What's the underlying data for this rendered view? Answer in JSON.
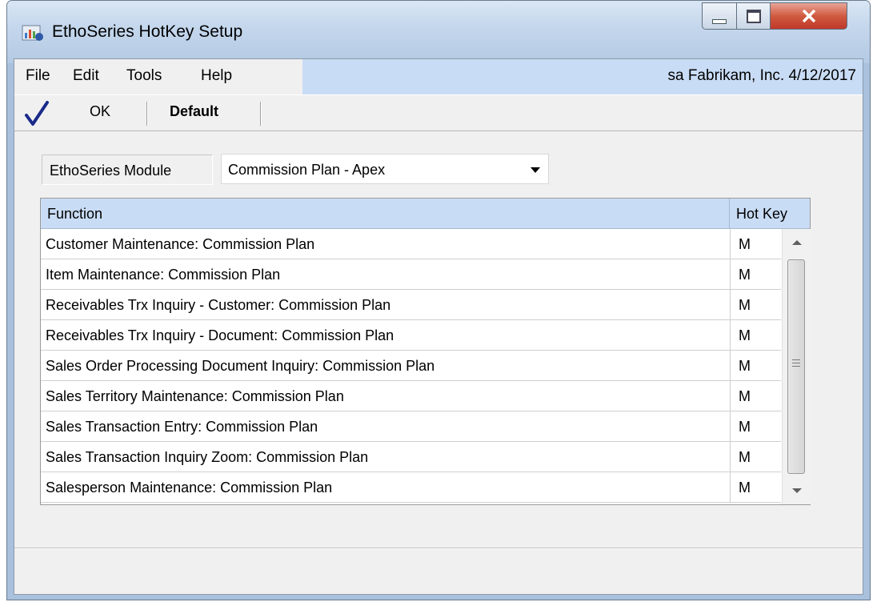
{
  "window": {
    "title": "EthoSeries HotKey Setup"
  },
  "menu": {
    "file": "File",
    "edit": "Edit",
    "tools": "Tools",
    "help": "Help",
    "info": "sa  Fabrikam, Inc.  4/12/2017"
  },
  "toolbar": {
    "ok_label": "OK",
    "default_label": "Default"
  },
  "module": {
    "label": "EthoSeries Module",
    "value": "Commission Plan - Apex"
  },
  "grid": {
    "columns": {
      "function": "Function",
      "hotkey": "Hot Key"
    },
    "rows": [
      {
        "function": "Customer Maintenance: Commission Plan",
        "hotkey": "M"
      },
      {
        "function": "Item Maintenance: Commission Plan",
        "hotkey": "M"
      },
      {
        "function": "Receivables Trx Inquiry - Customer: Commission Plan",
        "hotkey": "M"
      },
      {
        "function": "Receivables Trx Inquiry - Document: Commission Plan",
        "hotkey": "M"
      },
      {
        "function": "Sales Order Processing Document Inquiry: Commission Plan",
        "hotkey": "M"
      },
      {
        "function": "Sales Territory Maintenance: Commission Plan",
        "hotkey": "M"
      },
      {
        "function": "Sales Transaction Entry: Commission Plan",
        "hotkey": "M"
      },
      {
        "function": "Sales Transaction Inquiry Zoom: Commission Plan",
        "hotkey": "M"
      },
      {
        "function": "Salesperson Maintenance: Commission Plan",
        "hotkey": "M"
      }
    ]
  },
  "icons": {
    "app": "app-icon",
    "ok": "checkmark-icon",
    "minimize": "minimize-icon",
    "maximize": "maximize-icon",
    "close": "close-icon"
  },
  "colors": {
    "header_bg": "#c9dcf5",
    "close_button": "#c0392b",
    "checkmark": "#1a2a8a"
  }
}
